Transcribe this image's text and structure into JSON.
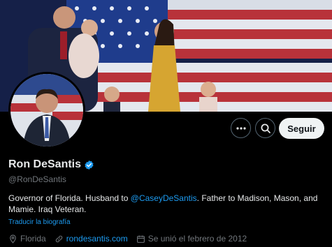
{
  "profile": {
    "display_name": "Ron DeSantis",
    "handle": "@RonDeSantis",
    "verified_badge": "verified-badge-icon",
    "bio_part1": "Governor of Florida. Husband to ",
    "bio_mention": "@CaseyDeSantis",
    "bio_part2": ". Father to Madison, Mason, and Mamie. Iraq Veteran.",
    "translate_link": "Traducir la biografía",
    "location": "Florida",
    "website": "rondesantis.com",
    "joined": "Se unió el febrero de 2012"
  },
  "actions": {
    "more_icon": "more-options-icon",
    "search_icon": "search-icon",
    "follow_label": "Seguir"
  },
  "colors": {
    "background": "#000000",
    "accent": "#1d9bf0",
    "secondary_text": "#71767b",
    "follow_button_bg": "#eff3f4"
  }
}
